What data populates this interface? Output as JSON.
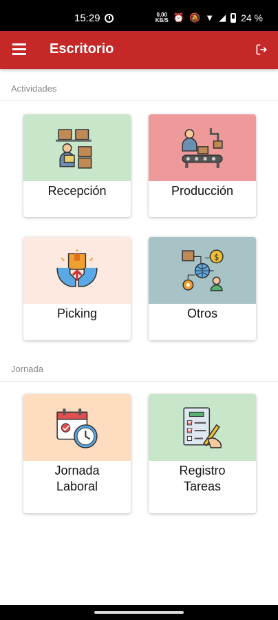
{
  "status": {
    "time": "15:29",
    "data_speed_top": "0,00",
    "data_speed_bottom": "KB/S",
    "battery": "24 %",
    "icons": [
      "clock-icon",
      "data-speed-icon",
      "alarm-icon",
      "mute-icon",
      "wifi-icon",
      "signal-icon",
      "battery-icon"
    ]
  },
  "app_bar": {
    "title": "Escritorio",
    "background": "#c62828",
    "icons": [
      "menu-icon",
      "logout-icon"
    ]
  },
  "sections": {
    "activities": {
      "label": "Actividades"
    },
    "workday": {
      "label": "Jornada"
    }
  },
  "cards": {
    "reception": {
      "label": "Recepción",
      "color": "#c8e6c9",
      "icon": "warehouse-worker-icon"
    },
    "production": {
      "label": "Producción",
      "color": "#ef9a9a",
      "icon": "conveyor-worker-icon"
    },
    "picking": {
      "label": "Picking",
      "color": "#fde9df",
      "icon": "box-hands-icon"
    },
    "others": {
      "label": "Otros",
      "color": "#a7c3c6",
      "icon": "network-settings-icon"
    },
    "workday": {
      "label_line1": "Jornada",
      "label_line2": "Laboral",
      "color": "#fddcc0",
      "icon": "calendar-clock-icon"
    },
    "task_log": {
      "label_line1": "Registro",
      "label_line2": "Tareas",
      "color": "#c8e6c9",
      "icon": "checklist-hand-icon"
    }
  }
}
